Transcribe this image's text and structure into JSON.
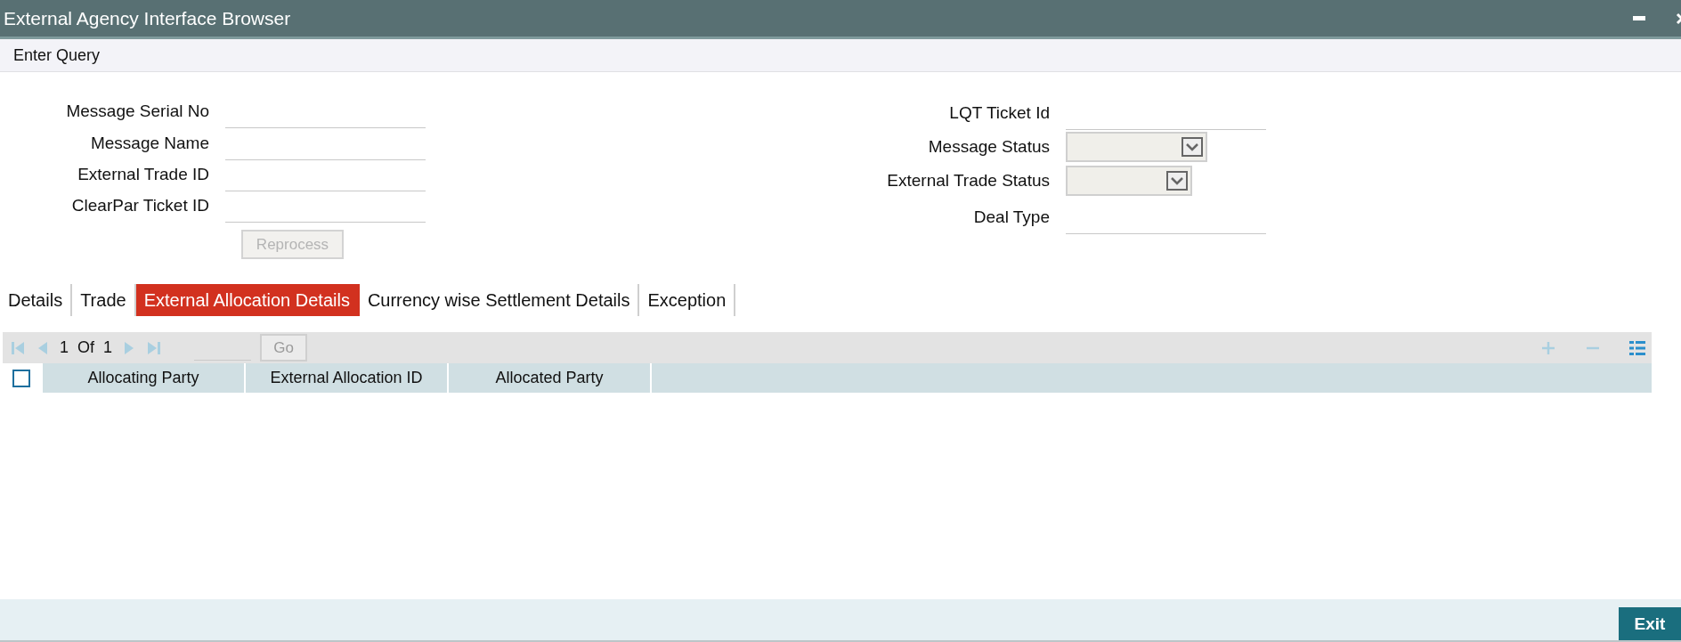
{
  "window": {
    "title": "External Agency Interface Browser"
  },
  "menu": {
    "label": "Enter Query"
  },
  "form": {
    "left": [
      {
        "label": "Message Serial No",
        "kind": "text"
      },
      {
        "label": "Message Name",
        "kind": "text"
      },
      {
        "label": "External Trade ID",
        "kind": "text"
      },
      {
        "label": "ClearPar Ticket ID",
        "kind": "text"
      }
    ],
    "reprocess_button": {
      "label": "Reprocess",
      "disabled": true
    },
    "right": [
      {
        "label": "LQT Ticket Id",
        "kind": "text"
      },
      {
        "label": "Message Status",
        "kind": "select"
      },
      {
        "label": "External Trade Status",
        "kind": "select"
      },
      {
        "label": "Deal Type",
        "kind": "text"
      }
    ]
  },
  "tabs": [
    {
      "label": "Details",
      "selected": false
    },
    {
      "label": "Trade",
      "selected": false
    },
    {
      "label": "External Allocation Details",
      "selected": true
    },
    {
      "label": "Currency wise Settlement Details",
      "selected": false
    },
    {
      "label": "Exception",
      "selected": false
    }
  ],
  "pager": {
    "page": "1",
    "of": "Of",
    "total": "1",
    "go": "Go"
  },
  "table": {
    "select_all_checked": false,
    "columns": [
      "Allocating Party",
      "External Allocation ID",
      "Allocated Party"
    ]
  },
  "footer": {
    "exit_button": "Exit"
  }
}
